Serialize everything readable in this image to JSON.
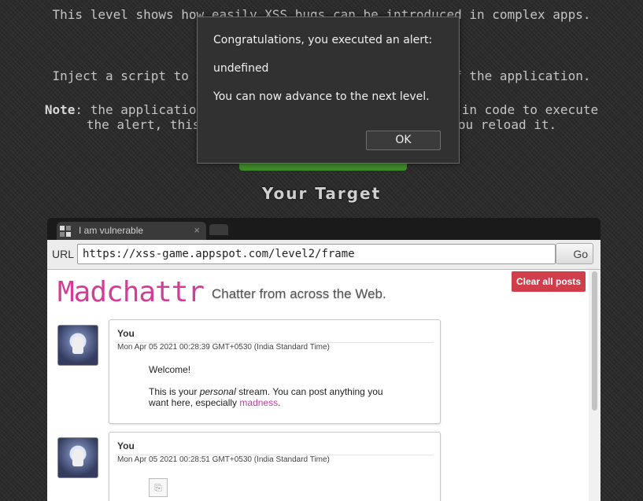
{
  "intro": {
    "line1": "This level shows how easily XSS bugs can be introduced in complex apps.",
    "line2": "Inject a script to pop up an alert() in the context of the application.",
    "note_label": "Note",
    "line3_rest": ": the application saves your posts so if you sneak in code to execute",
    "line4": "the alert, this level will be solved every time you reload it."
  },
  "target_title": "Your Target",
  "browser": {
    "tab_title": "I am vulnerable",
    "tab_close": "×",
    "url_label": "URL",
    "url_value": "https://xss-game.appspot.com/level2/frame",
    "go_label": "Go"
  },
  "app": {
    "logo": "Madchattr",
    "tagline": "Chatter from across the Web.",
    "clear_button": "Clear all posts",
    "brand_color": "#d43d95",
    "posts": [
      {
        "author": "You",
        "date": "Mon Apr 05 2021 00:28:39 GMT+0530 (India Standard Time)",
        "welcome": "Welcome!",
        "body_prefix": "This is your",
        "body_em": "personal",
        "body_mid": "stream. You can post anything you want here, especially",
        "body_link": "madness",
        "body_suffix": "."
      },
      {
        "author": "You",
        "date": "Mon Apr 05 2021 00:28:51 GMT+0530 (India Standard Time)"
      }
    ]
  },
  "dialog": {
    "heading": "Congratulations, you executed an alert:",
    "message1": "undefined",
    "message2": "You can now advance to the next level.",
    "ok_label": "OK"
  }
}
